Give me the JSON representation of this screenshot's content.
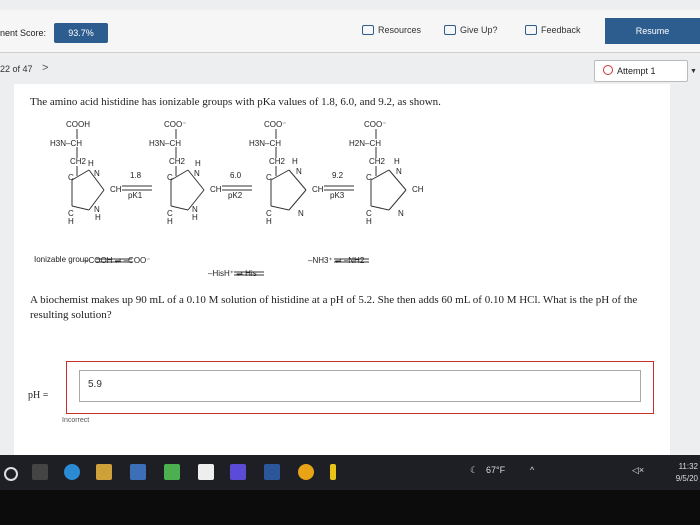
{
  "topbar": {
    "score_label": "nent Score:",
    "score_value": "93.7%",
    "resources_label": "Resources",
    "give_up_label": "Give Up?",
    "feedback_label": "Feedback",
    "resume_label": "Resume"
  },
  "subbar": {
    "question_count": "22 of 47",
    "next_chevron": ">",
    "attempt_label": "Attempt 1"
  },
  "question": {
    "intro": "The amino acid histidine has ionizable groups with pKa values of 1.8, 6.0, and 9.2, as shown.",
    "body": "A biochemist makes up 90 mL of a 0.10 M solution of histidine at a pH of 5.2. She then adds 60 mL of 0.10 M HCl. What is the pH of the resulting solution?",
    "answer_label": "pH =",
    "answer_value": "5.9",
    "feedback": "Incorrect"
  },
  "figure": {
    "structures": [
      {
        "carboxyl": "COOH",
        "amine": "H3N–CH",
        "chain": "CH2",
        "ring": "imidazole (protonated)"
      },
      {
        "carboxyl": "COO⁻",
        "amine": "H3N–CH",
        "chain": "CH2",
        "ring": "imidazole (protonated)"
      },
      {
        "carboxyl": "COO⁻",
        "amine": "H3N–CH",
        "chain": "CH2",
        "ring": "imidazole"
      },
      {
        "carboxyl": "COO⁻",
        "amine": "H2N–CH",
        "chain": "CH2",
        "ring": "imidazole"
      }
    ],
    "pka_values": [
      {
        "value": "1.8",
        "label": "pK1"
      },
      {
        "value": "6.0",
        "label": "pK2"
      },
      {
        "value": "9.2",
        "label": "pK3"
      }
    ],
    "row_label": "Ionizable group",
    "transitions": [
      "–COOH ⇌ –COO⁻",
      "–HisH⁺ ⇌ His",
      "–NH3⁺ ⇌ –NH2"
    ]
  },
  "taskbar": {
    "weather": "67°F",
    "time": "11:32",
    "date": "9/5/20"
  }
}
